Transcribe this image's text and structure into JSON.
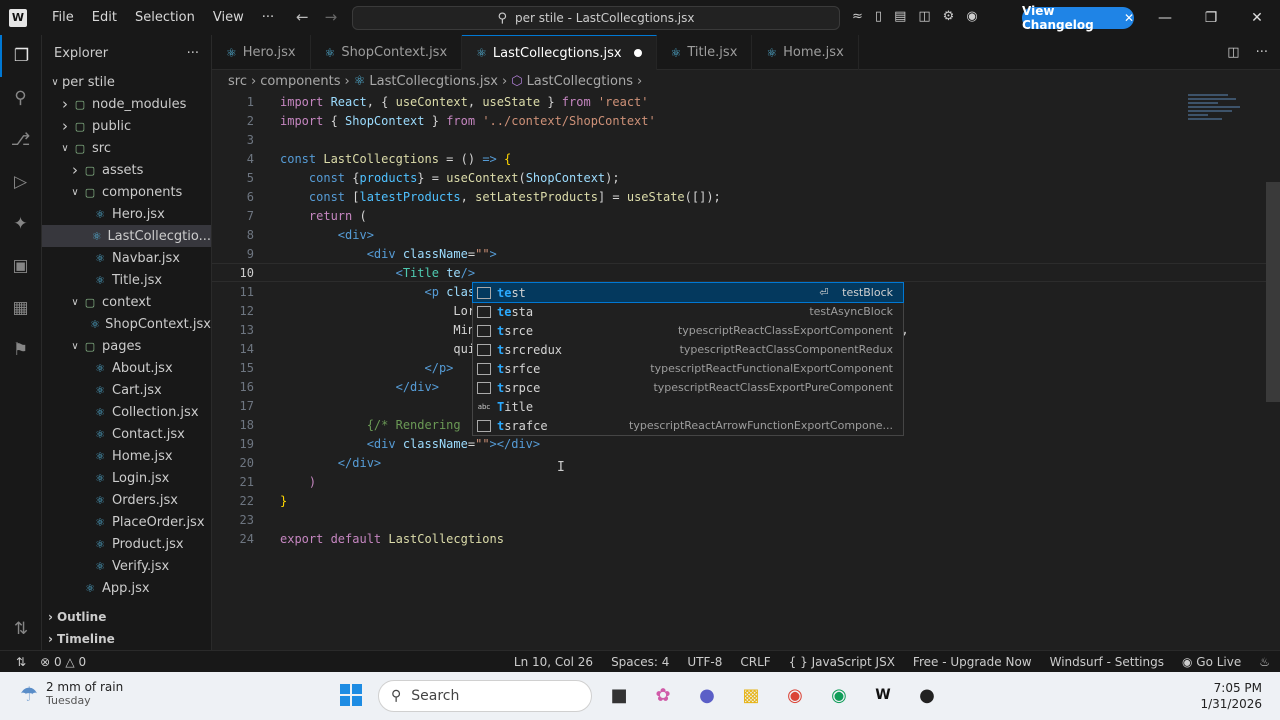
{
  "titlebar": {
    "menus": [
      "File",
      "Edit",
      "Selection",
      "View",
      "···"
    ],
    "command_center": "per stile - LastCollecgtions.jsx",
    "changelog_button": "View Changelog"
  },
  "sidebar": {
    "title": "Explorer",
    "tree": [
      {
        "label": "per stile",
        "depth": 0,
        "kind": "root"
      },
      {
        "label": "node_modules",
        "depth": 1,
        "kind": "folder-closed"
      },
      {
        "label": "public",
        "depth": 1,
        "kind": "folder-closed"
      },
      {
        "label": "src",
        "depth": 1,
        "kind": "folder-open"
      },
      {
        "label": "assets",
        "depth": 2,
        "kind": "folder-closed"
      },
      {
        "label": "components",
        "depth": 2,
        "kind": "folder-open"
      },
      {
        "label": "Hero.jsx",
        "depth": 3,
        "kind": "file"
      },
      {
        "label": "LastCollecgtio...",
        "depth": 3,
        "kind": "file",
        "selected": true
      },
      {
        "label": "Navbar.jsx",
        "depth": 3,
        "kind": "file"
      },
      {
        "label": "Title.jsx",
        "depth": 3,
        "kind": "file"
      },
      {
        "label": "context",
        "depth": 2,
        "kind": "folder-open"
      },
      {
        "label": "ShopContext.jsx",
        "depth": 3,
        "kind": "file"
      },
      {
        "label": "pages",
        "depth": 2,
        "kind": "folder-open"
      },
      {
        "label": "About.jsx",
        "depth": 3,
        "kind": "file"
      },
      {
        "label": "Cart.jsx",
        "depth": 3,
        "kind": "file"
      },
      {
        "label": "Collection.jsx",
        "depth": 3,
        "kind": "file"
      },
      {
        "label": "Contact.jsx",
        "depth": 3,
        "kind": "file"
      },
      {
        "label": "Home.jsx",
        "depth": 3,
        "kind": "file"
      },
      {
        "label": "Login.jsx",
        "depth": 3,
        "kind": "file"
      },
      {
        "label": "Orders.jsx",
        "depth": 3,
        "kind": "file"
      },
      {
        "label": "PlaceOrder.jsx",
        "depth": 3,
        "kind": "file"
      },
      {
        "label": "Product.jsx",
        "depth": 3,
        "kind": "file"
      },
      {
        "label": "Verify.jsx",
        "depth": 3,
        "kind": "file"
      },
      {
        "label": "App.jsx",
        "depth": 2,
        "kind": "file"
      }
    ],
    "sections": [
      "Outline",
      "Timeline"
    ]
  },
  "tabs": [
    {
      "label": "Hero.jsx",
      "active": false
    },
    {
      "label": "ShopContext.jsx",
      "active": false
    },
    {
      "label": "LastCollecgtions.jsx",
      "active": true,
      "dirty": true
    },
    {
      "label": "Title.jsx",
      "active": false
    },
    {
      "label": "Home.jsx",
      "active": false
    }
  ],
  "breadcrumb": [
    "src",
    "components",
    "LastCollecgtions.jsx",
    "LastCollecgtions"
  ],
  "editor": {
    "current_line": 10,
    "lines": [
      [
        [
          "kw",
          "import "
        ],
        [
          "vr",
          "React"
        ],
        [
          "tx",
          ", { "
        ],
        [
          "fn",
          "useContext"
        ],
        [
          "tx",
          ", "
        ],
        [
          "fn",
          "useState"
        ],
        [
          "tx",
          " } "
        ],
        [
          "kw",
          "from "
        ],
        [
          "st",
          "'react'"
        ]
      ],
      [
        [
          "kw",
          "import "
        ],
        [
          "tx",
          "{ "
        ],
        [
          "vr",
          "ShopContext"
        ],
        [
          "tx",
          " } "
        ],
        [
          "kw",
          "from "
        ],
        [
          "st",
          "'../context/ShopContext'"
        ]
      ],
      [],
      [
        [
          "kb",
          "const "
        ],
        [
          "fn",
          "LastCollecgtions"
        ],
        [
          "tx",
          " = () "
        ],
        [
          "kb",
          "=>"
        ],
        [
          "tx",
          " "
        ],
        [
          "br",
          "{"
        ]
      ],
      [
        [
          "tx",
          "    "
        ],
        [
          "kb",
          "const "
        ],
        [
          "tx",
          "{"
        ],
        [
          "vc",
          "products"
        ],
        [
          "tx",
          "} = "
        ],
        [
          "fn",
          "useContext"
        ],
        [
          "tx",
          "("
        ],
        [
          "vr",
          "ShopContext"
        ],
        [
          "tx",
          ");"
        ]
      ],
      [
        [
          "tx",
          "    "
        ],
        [
          "kb",
          "const "
        ],
        [
          "tx",
          "["
        ],
        [
          "vc",
          "latestProducts"
        ],
        [
          "tx",
          ", "
        ],
        [
          "fn",
          "setLatestProducts"
        ],
        [
          "tx",
          "] = "
        ],
        [
          "fn",
          "useState"
        ],
        [
          "tx",
          "([]);"
        ]
      ],
      [
        [
          "tx",
          "    "
        ],
        [
          "kw",
          "return "
        ],
        [
          "tx",
          "("
        ]
      ],
      [
        [
          "tx",
          "        "
        ],
        [
          "tg",
          "<div>"
        ]
      ],
      [
        [
          "tx",
          "            "
        ],
        [
          "tg",
          "<div "
        ],
        [
          "vr",
          "className"
        ],
        [
          "tx",
          "="
        ],
        [
          "st",
          "\"\""
        ],
        [
          "tg",
          ">"
        ]
      ],
      [
        [
          "tx",
          "                "
        ],
        [
          "tg",
          "<"
        ],
        [
          "cl",
          "Title "
        ],
        [
          "vr",
          "te"
        ],
        [
          "tg",
          "/>"
        ]
      ],
      [
        [
          "tx",
          "                    "
        ],
        [
          "tg",
          "<p "
        ],
        [
          "vr",
          "classN"
        ]
      ],
      [
        [
          "tx",
          "                        "
        ],
        [
          "tx",
          "Lorem"
        ]
      ],
      [
        [
          "tx",
          "                        "
        ],
        [
          "tx",
          "Minim"
        ],
        [
          "tx",
          "                                                        m,"
        ]
      ],
      [
        [
          "tx",
          "                        "
        ],
        [
          "tx",
          "quibu"
        ]
      ],
      [
        [
          "tx",
          "                    "
        ],
        [
          "tg",
          "</p>"
        ]
      ],
      [
        [
          "tx",
          "                "
        ],
        [
          "tg",
          "</div>"
        ]
      ],
      [],
      [
        [
          "tx",
          "            "
        ],
        [
          "cm",
          "{/* Rendering"
        ]
      ],
      [
        [
          "tx",
          "            "
        ],
        [
          "tg",
          "<div "
        ],
        [
          "vr",
          "className"
        ],
        [
          "tx",
          "="
        ],
        [
          "st",
          "\"\""
        ],
        [
          "tg",
          "></div>"
        ]
      ],
      [
        [
          "tx",
          "        "
        ],
        [
          "tg",
          "</div>"
        ]
      ],
      [
        [
          "tx",
          "    "
        ],
        [
          "kw",
          ")"
        ]
      ],
      [
        [
          "br",
          "}"
        ]
      ],
      [],
      [
        [
          "kw",
          "export "
        ],
        [
          "kw",
          "default "
        ],
        [
          "fn",
          "LastCollecgtions"
        ]
      ]
    ]
  },
  "suggestions": [
    {
      "match": "te",
      "rest": "st",
      "detail": "testBlock",
      "icon": "snippet",
      "selected": true
    },
    {
      "match": "te",
      "rest": "sta",
      "detail": "testAsyncBlock",
      "icon": "snippet"
    },
    {
      "match": "t",
      "rest": "srce",
      "detail": "typescriptReactClassExportComponent",
      "icon": "snippet"
    },
    {
      "match": "t",
      "rest": "srcredux",
      "detail": "typescriptReactClassComponentRedux",
      "icon": "snippet"
    },
    {
      "match": "t",
      "rest": "srfce",
      "detail": "typescriptReactFunctionalExportComponent",
      "icon": "snippet"
    },
    {
      "match": "t",
      "rest": "srpce",
      "detail": "typescriptReactClassExportPureComponent",
      "icon": "snippet"
    },
    {
      "match": "T",
      "rest": "itle",
      "detail": "",
      "icon": "text"
    },
    {
      "match": "t",
      "rest": "srafce",
      "detail": "typescriptReactArrowFunctionExportCompone...",
      "icon": "snippet"
    }
  ],
  "statusbar": {
    "problems": "0",
    "warnings": "0",
    "position": "Ln 10, Col 26",
    "spaces": "Spaces: 4",
    "encoding": "UTF-8",
    "eol": "CRLF",
    "language": "{ } JavaScript JSX",
    "upgrade": "Free - Upgrade Now",
    "windsurf": "Windsurf - Settings",
    "golive": "Go Live"
  },
  "taskbar": {
    "weather_line1": "2 mm of rain",
    "weather_line2": "Tuesday",
    "search_placeholder": "Search",
    "time": "7:05 PM",
    "date": "1/31/2026"
  }
}
